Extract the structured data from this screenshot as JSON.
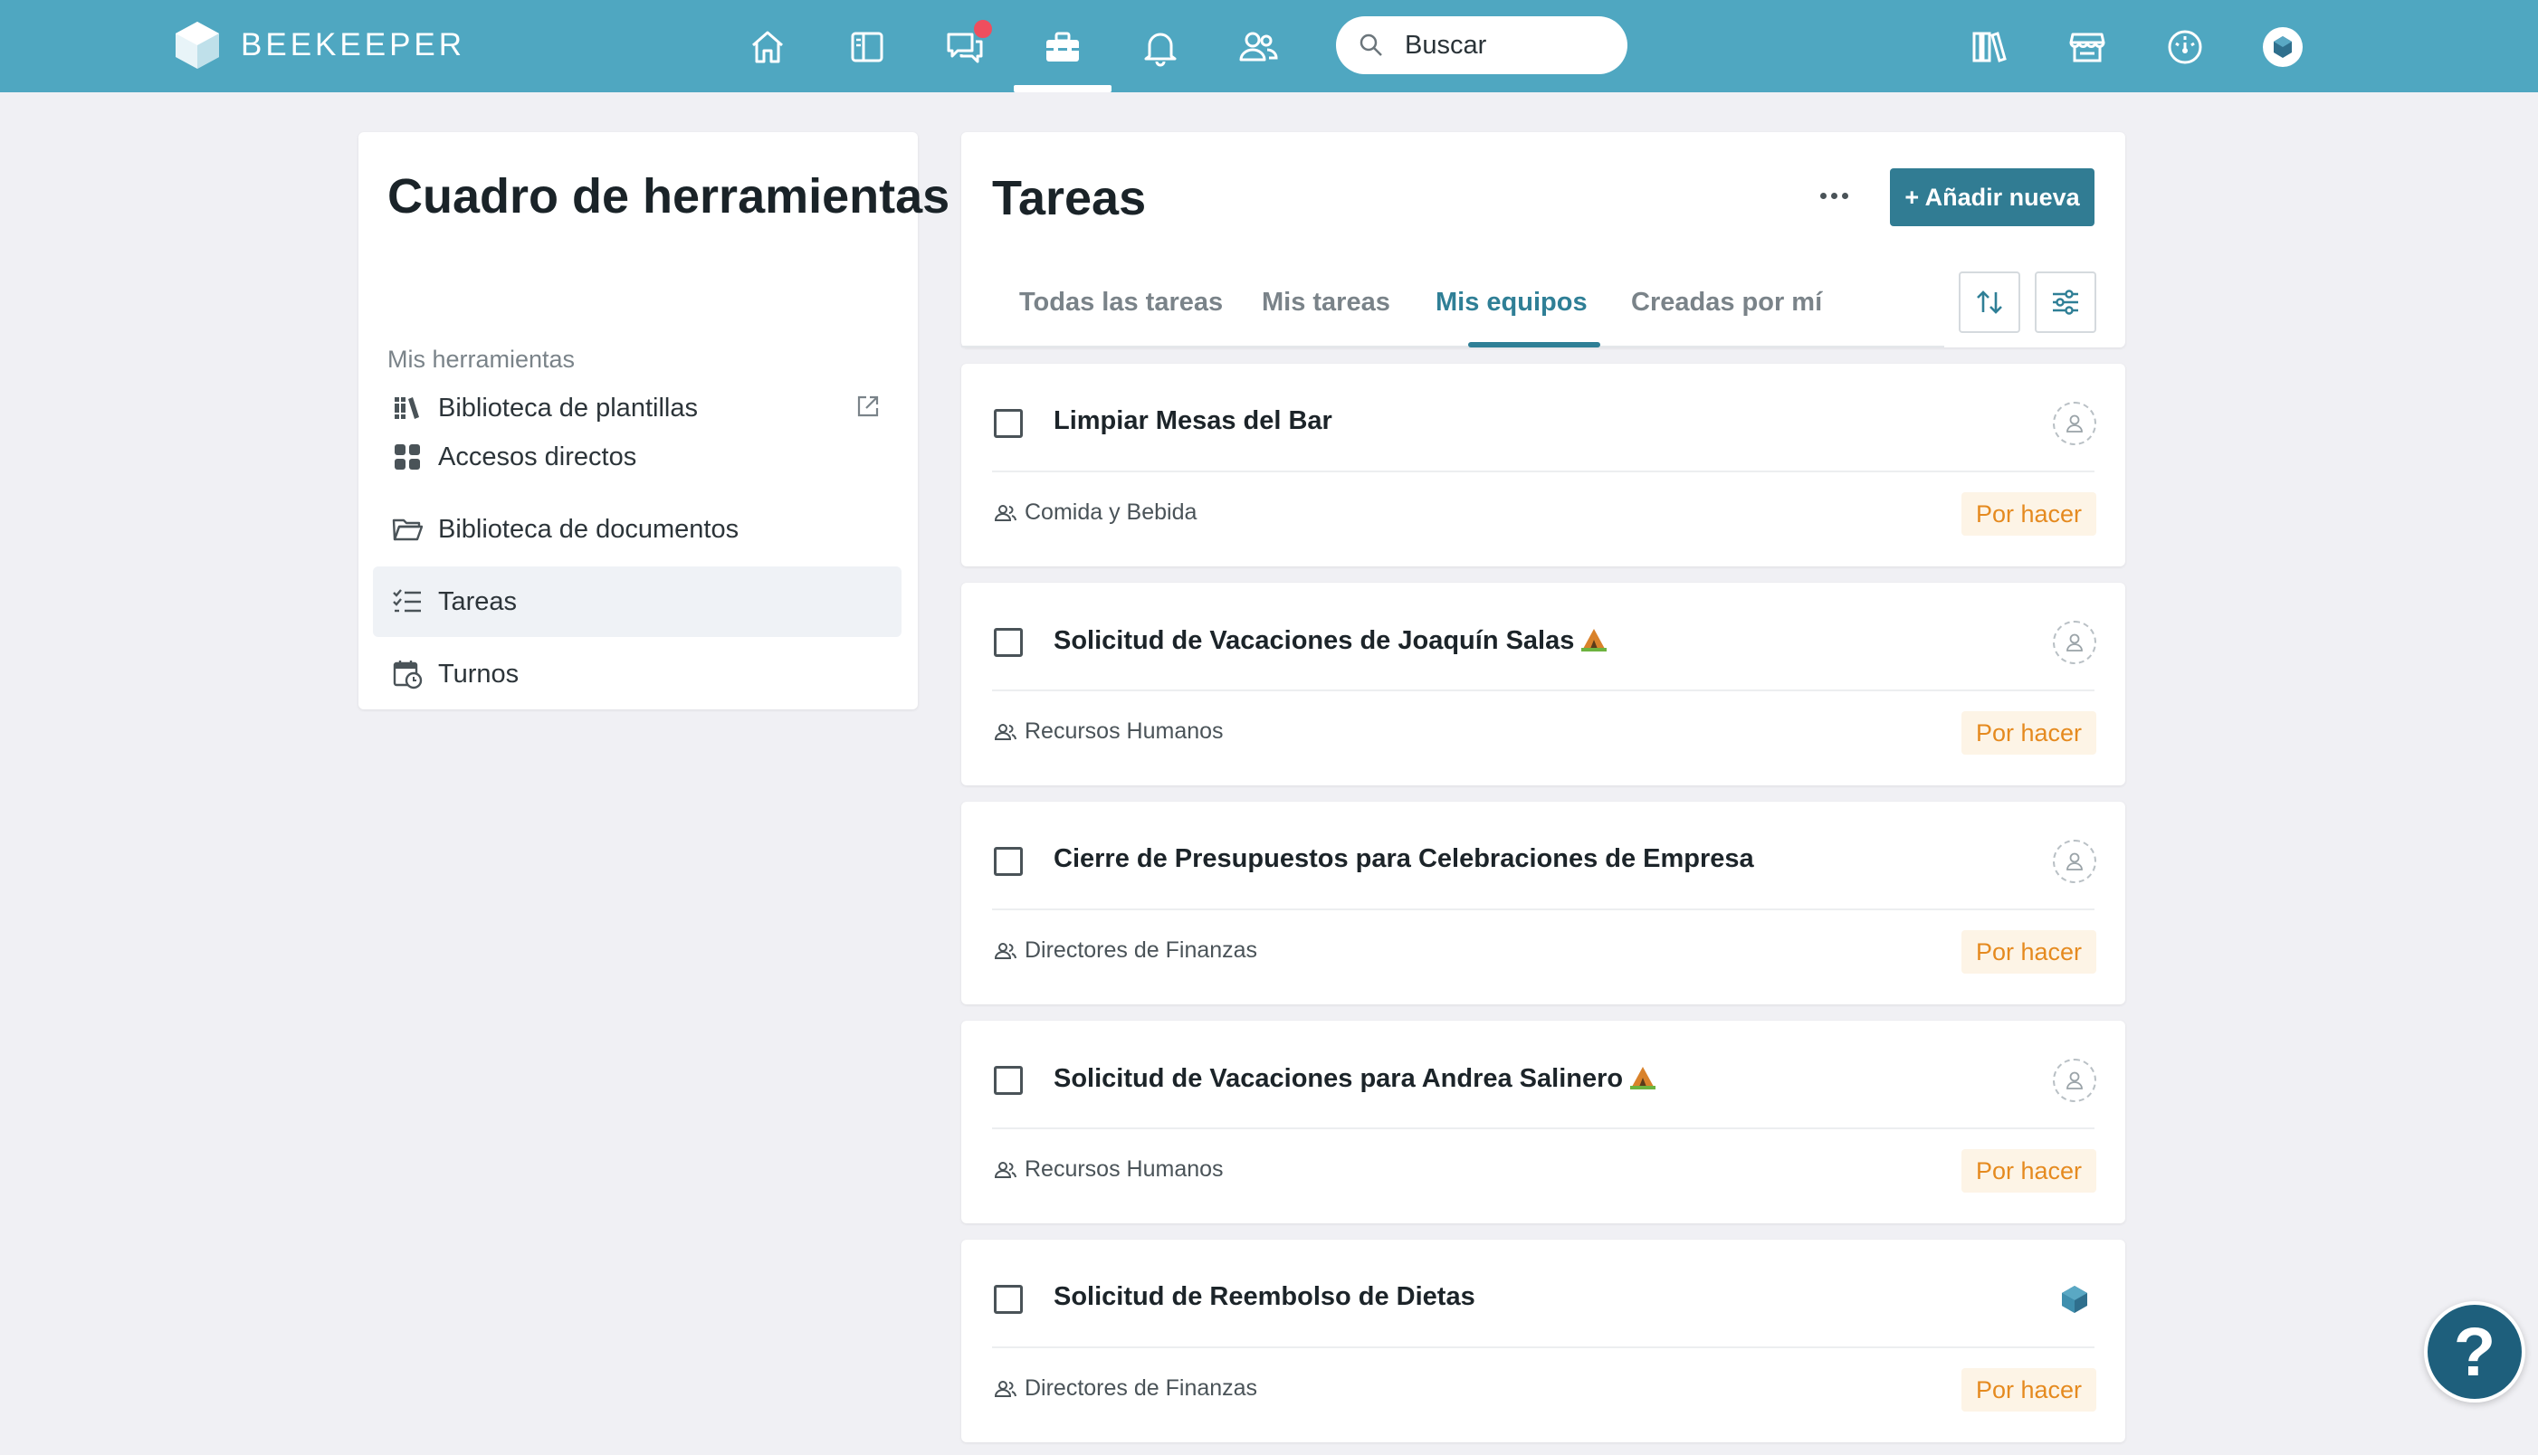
{
  "brand": {
    "name": "BEEKEEPER"
  },
  "topnav": {
    "items": [
      {
        "icon": "home-icon"
      },
      {
        "icon": "streams-icon"
      },
      {
        "icon": "chat-icon",
        "has_notification": true
      },
      {
        "icon": "toolbox-icon",
        "active": true
      },
      {
        "icon": "bell-icon"
      },
      {
        "icon": "people-icon"
      }
    ],
    "search": {
      "placeholder": "Buscar"
    },
    "right_icons": [
      "library-icon",
      "store-icon",
      "dashboard-icon",
      "profile-avatar-icon"
    ]
  },
  "sidebar": {
    "title": "Cuadro de herramientas",
    "template_library": {
      "label": "Biblioteca de plantillas",
      "icon": "library-icon",
      "external": true
    },
    "section_label": "Mis herramientas",
    "items": [
      {
        "label": "Accesos directos",
        "icon": "grid-icon",
        "active": false
      },
      {
        "label": "Biblioteca de documentos",
        "icon": "folder-icon",
        "active": false
      },
      {
        "label": "Tareas",
        "icon": "checklist-icon",
        "active": true
      },
      {
        "label": "Turnos",
        "icon": "calendar-clock-icon",
        "active": false
      }
    ]
  },
  "tasks": {
    "title": "Tareas",
    "more_label": "...",
    "add_button": "+ Añadir nueva",
    "tabs": [
      {
        "label": "Todas las tareas",
        "active": false
      },
      {
        "label": "Mis tareas",
        "active": false
      },
      {
        "label": "Mis equipos",
        "active": true
      },
      {
        "label": "Creadas por mí",
        "active": false
      }
    ],
    "list": [
      {
        "title": "Limpiar Mesas del Bar",
        "emoji": false,
        "team": "Comida y Bebida",
        "status": "Por hacer",
        "assignee": "unassigned"
      },
      {
        "title": "Solicitud de Vacaciones de Joaquín Salas",
        "emoji": true,
        "team": "Recursos Humanos",
        "status": "Por hacer",
        "assignee": "unassigned"
      },
      {
        "title": "Cierre de Presupuestos para Celebraciones de Empresa",
        "emoji": false,
        "team": "Directores de Finanzas",
        "status": "Por hacer",
        "assignee": "unassigned"
      },
      {
        "title": "Solicitud de Vacaciones para Andrea Salinero",
        "emoji": true,
        "team": "Recursos Humanos",
        "status": "Por hacer",
        "assignee": "unassigned"
      },
      {
        "title": "Solicitud de Reembolso de Dietas",
        "emoji": false,
        "team": "Directores de Finanzas",
        "status": "Por hacer",
        "assignee": "beekeeper"
      }
    ]
  },
  "help": {
    "label": "?"
  },
  "colors": {
    "topbar": "#4fa7c1",
    "accent": "#2f7f96",
    "button": "#317c93",
    "status_text": "#e58a1f",
    "status_bg": "#fdf4e6",
    "notification": "#ef4e5e"
  }
}
